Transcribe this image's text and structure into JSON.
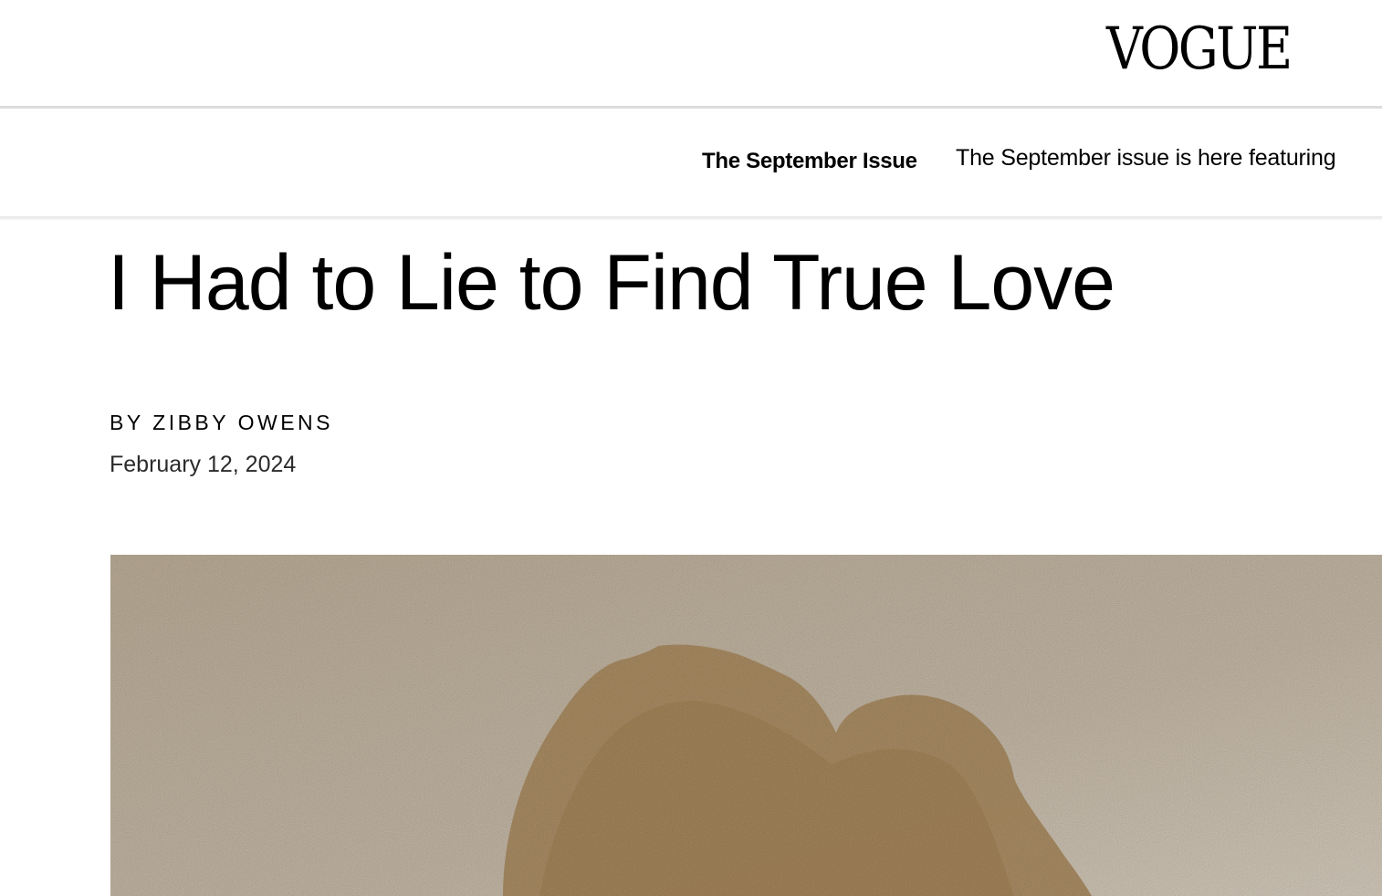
{
  "masthead": {
    "logo_text": "VOGUE"
  },
  "ticker": {
    "label": "The September Issue",
    "text": "The September issue is here featuring"
  },
  "article": {
    "headline": "I Had to Lie to Find True Love",
    "byline_prefix": "BY",
    "author": "ZIBBY OWENS",
    "date": "February 12, 2024"
  },
  "lead_image": {
    "description_icon": "sand-heart-photo",
    "colors": {
      "sand": "#b9ab98",
      "heart": "#9c7c4f"
    }
  }
}
